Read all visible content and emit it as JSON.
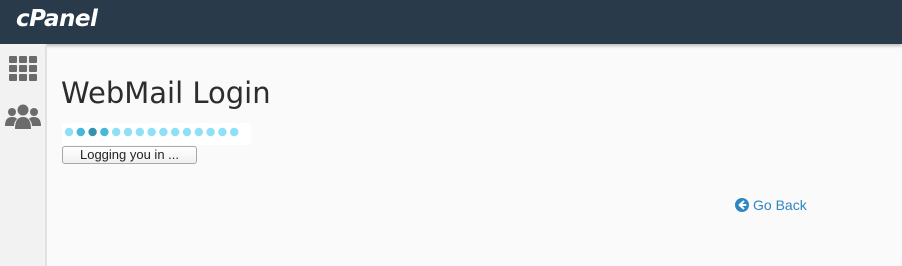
{
  "header": {
    "logo_text": "cPanel"
  },
  "sidebar": {
    "items": [
      {
        "icon": "grid-icon",
        "label": ""
      },
      {
        "icon": "users-icon",
        "label": ""
      }
    ]
  },
  "main": {
    "title": "WebMail Login",
    "status_button_label": "Logging you in ...",
    "go_back_label": "Go Back",
    "loader": {
      "dot_count": 15,
      "colors": {
        "idle": "#8ee0f6",
        "active": "#47b8d8",
        "active_dark": "#3392b0"
      }
    }
  },
  "colors": {
    "header_bg": "#293a4a",
    "sidebar_bg": "#f2f2f2",
    "link": "#2e86c1"
  }
}
